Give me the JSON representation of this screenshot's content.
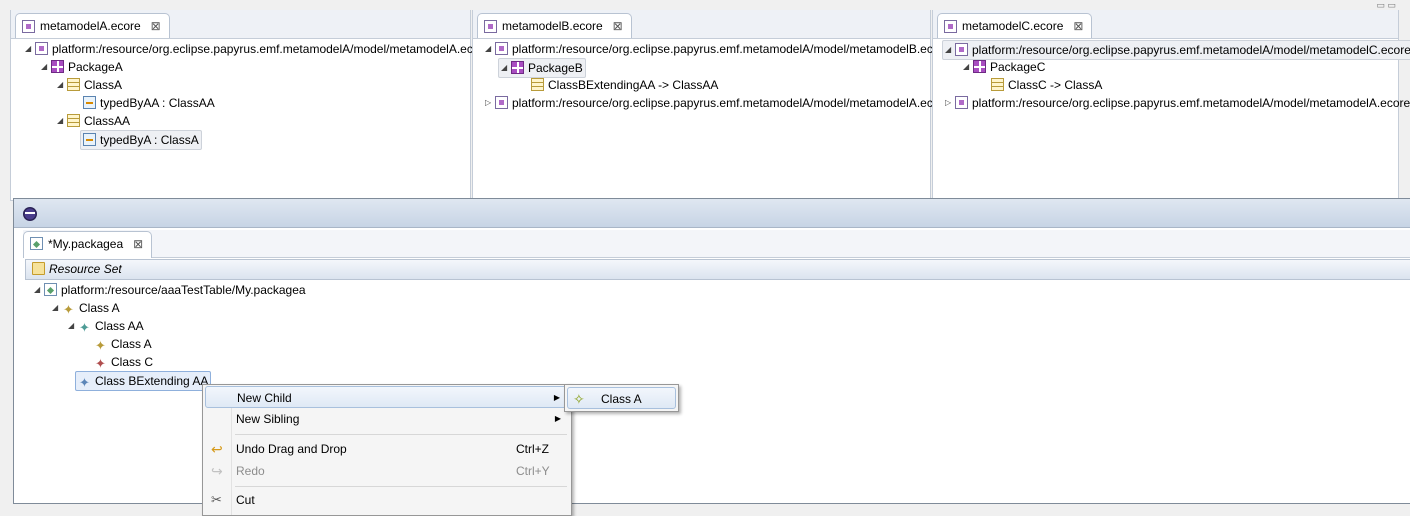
{
  "colors": {
    "accent": "#3875d7",
    "tab_border": "#b8c3d2",
    "package": "#a94dc1",
    "class": "#b89b3a"
  },
  "panes": [
    {
      "tab_label": "metamodelA.ecore",
      "rows": [
        {
          "text": "platform:/resource/org.eclipse.papyrus.emf.metamodelA/model/metamodelA.ecore",
          "icon": "ecore-document-icon"
        },
        {
          "text": "PackageA",
          "icon": "package-icon"
        },
        {
          "text": "ClassA",
          "icon": "class-icon"
        },
        {
          "text": "typedByAA : ClassAA",
          "icon": "reference-icon"
        },
        {
          "text": "ClassAA",
          "icon": "class-icon"
        },
        {
          "text": "typedByA : ClassA",
          "icon": "reference-icon"
        }
      ]
    },
    {
      "tab_label": "metamodelB.ecore",
      "rows": [
        {
          "text": "platform:/resource/org.eclipse.papyrus.emf.metamodelA/model/metamodelB.ecore",
          "icon": "ecore-document-icon"
        },
        {
          "text": "PackageB",
          "icon": "package-icon"
        },
        {
          "text": "ClassBExtendingAA -> ClassAA",
          "icon": "class-icon"
        },
        {
          "text": "platform:/resource/org.eclipse.papyrus.emf.metamodelA/model/metamodelA.ecore",
          "icon": "ecore-document-icon"
        }
      ]
    },
    {
      "tab_label": "metamodelC.ecore",
      "rows": [
        {
          "text": "platform:/resource/org.eclipse.papyrus.emf.metamodelA/model/metamodelC.ecore",
          "icon": "ecore-document-icon"
        },
        {
          "text": "PackageC",
          "icon": "package-icon"
        },
        {
          "text": "ClassC -> ClassA",
          "icon": "class-icon"
        },
        {
          "text": "platform:/resource/org.eclipse.papyrus.emf.metamodelA/model/metamodelA.ecore",
          "icon": "ecore-document-icon"
        }
      ]
    }
  ],
  "editor": {
    "tab_label": "*My.packagea",
    "resource_set_label": "Resource Set",
    "tree": [
      {
        "text": "platform:/resource/aaaTestTable/My.packagea",
        "icon": "model-file-icon"
      },
      {
        "text": "Class A",
        "icon": "class-a-icon"
      },
      {
        "text": "Class AA",
        "icon": "class-aa-icon"
      },
      {
        "text": "Class A",
        "icon": "class-a-icon"
      },
      {
        "text": "Class C",
        "icon": "class-c-icon"
      },
      {
        "text": "Class BExtending AA",
        "icon": "class-b-icon"
      }
    ]
  },
  "context_menu": {
    "items": [
      {
        "label": "New Child",
        "shortcut": "",
        "has_submenu": true
      },
      {
        "label": "New Sibling",
        "shortcut": "",
        "has_submenu": true
      },
      {
        "label": "Undo Drag and Drop",
        "shortcut": "Ctrl+Z",
        "icon": "undo-icon"
      },
      {
        "label": "Redo",
        "shortcut": "Ctrl+Y",
        "icon": "redo-icon",
        "disabled": true
      },
      {
        "label": "Cut",
        "shortcut": "",
        "icon": "cut-icon"
      }
    ],
    "submenu": {
      "label": "Class A",
      "icon": "new-class-a-icon"
    }
  }
}
